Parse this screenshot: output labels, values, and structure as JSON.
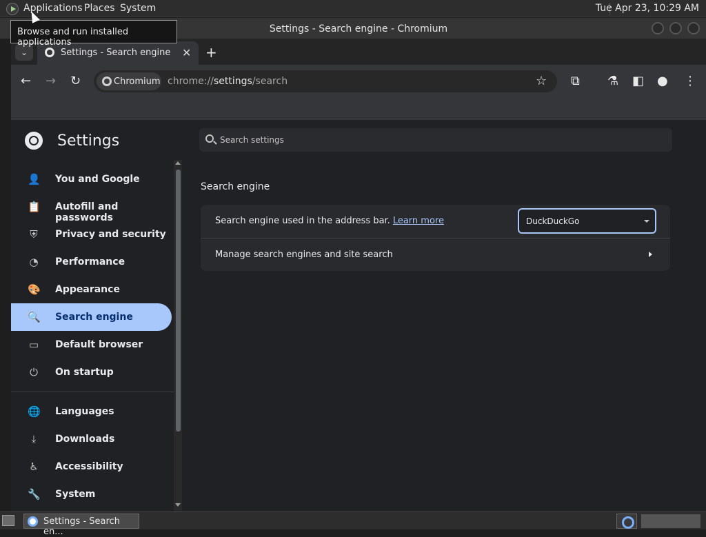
{
  "top_panel": {
    "menus": [
      "Applications",
      "Places",
      "System"
    ],
    "clock": "Tue Apr 23, 10:29 AM"
  },
  "tooltip": "Browse and run installed applications",
  "window": {
    "title": "Settings - Search engine - Chromium"
  },
  "tab": {
    "title": "Settings - Search engine",
    "close": "✕",
    "new_tab": "+"
  },
  "toolbar": {
    "chip_label": "Chromium",
    "url_scheme": "chrome://",
    "url_host": "settings",
    "url_path": "/search"
  },
  "settings": {
    "title": "Settings",
    "search_placeholder": "Search settings",
    "nav": [
      {
        "label": "You and Google",
        "icon": "person-icon"
      },
      {
        "label": "Autofill and passwords",
        "icon": "clipboard-icon"
      },
      {
        "label": "Privacy and security",
        "icon": "shield-icon"
      },
      {
        "label": "Performance",
        "icon": "speedometer-icon"
      },
      {
        "label": "Appearance",
        "icon": "palette-icon"
      },
      {
        "label": "Search engine",
        "icon": "search-icon"
      },
      {
        "label": "Default browser",
        "icon": "browser-icon"
      },
      {
        "label": "On startup",
        "icon": "power-icon"
      },
      {
        "label": "Languages",
        "icon": "globe-icon"
      },
      {
        "label": "Downloads",
        "icon": "download-icon"
      },
      {
        "label": "Accessibility",
        "icon": "accessibility-icon"
      },
      {
        "label": "System",
        "icon": "wrench-icon"
      }
    ],
    "active_item": "Search engine",
    "section_title": "Search engine",
    "row1_label": "Search engine used in the address bar.",
    "learn_more": "Learn more",
    "engine_selected": "DuckDuckGo",
    "row2_label": "Manage search engines and site search"
  },
  "taskbar": {
    "task_label": "Settings - Search en..."
  },
  "colors": {
    "accent": "#a8c7fa",
    "background": "#202124",
    "card": "#292a2d"
  }
}
